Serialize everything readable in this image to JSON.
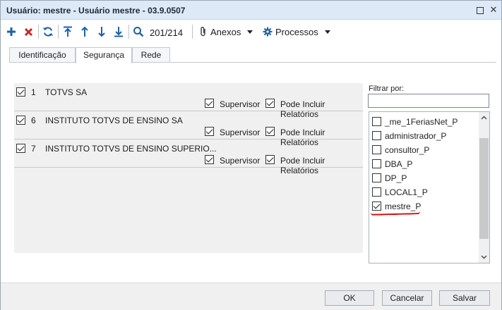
{
  "window": {
    "title": "Usuário: mestre - Usuário mestre - 03.9.0507"
  },
  "toolbar": {
    "counter": "201/214",
    "attachments_label": "Anexos",
    "processes_label": "Processos"
  },
  "tabs": [
    {
      "label": "Identificação",
      "active": false
    },
    {
      "label": "Segurança",
      "active": true
    },
    {
      "label": "Rede",
      "active": false
    }
  ],
  "companies": [
    {
      "checked": true,
      "code": "1",
      "name": "TOTVS SA",
      "supervisor": true,
      "can_include_reports": true
    },
    {
      "checked": true,
      "code": "6",
      "name": "INSTITUTO TOTVS DE ENSINO SA",
      "supervisor": true,
      "can_include_reports": true
    },
    {
      "checked": true,
      "code": "7",
      "name": "INSTITUTO TOTVS DE ENSINO SUPERIO...",
      "supervisor": true,
      "can_include_reports": true
    }
  ],
  "labels": {
    "supervisor": "Supervisor",
    "can_include_reports": "Pode Incluir Relatórios"
  },
  "filter": {
    "label": "Filtrar por:",
    "value": "",
    "placeholder": ""
  },
  "groups": [
    {
      "label": "_me_1FeriasNet_P",
      "checked": false
    },
    {
      "label": "administrador_P",
      "checked": false
    },
    {
      "label": "consultor_P",
      "checked": false
    },
    {
      "label": "DBA_P",
      "checked": false
    },
    {
      "label": "DP_P",
      "checked": false
    },
    {
      "label": "LOCAL1_P",
      "checked": false
    },
    {
      "label": "mestre_P",
      "checked": true
    }
  ],
  "footer": {
    "ok_label": "OK",
    "cancel_label": "Cancelar",
    "save_label": "Salvar"
  },
  "colors": {
    "accent_blue": "#1f5fa8",
    "delete_red": "#c62828",
    "annotation_red": "#e00000"
  }
}
